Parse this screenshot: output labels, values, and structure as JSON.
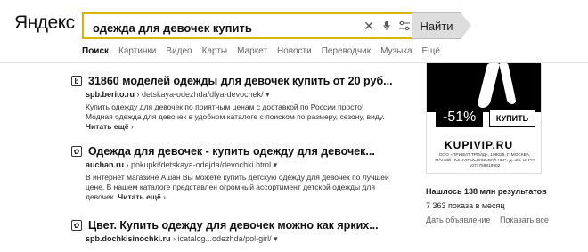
{
  "logo": {
    "text": "Яндекс"
  },
  "search": {
    "value": "одежда для девочек купить",
    "placeholder": "",
    "find_label": "Найти"
  },
  "tabs": [
    {
      "label": "Поиск"
    },
    {
      "label": "Картинки"
    },
    {
      "label": "Видео"
    },
    {
      "label": "Карты"
    },
    {
      "label": "Маркет"
    },
    {
      "label": "Новости"
    },
    {
      "label": "Переводчик"
    },
    {
      "label": "Музыка"
    },
    {
      "label": "Ещё"
    }
  ],
  "results": [
    {
      "title": "31860 моделей одежды для девочек купить от 20 руб...",
      "url_host": "spb.berito.ru",
      "url_path": "detskaya-odezhda/dlya-devochek/",
      "snippet_lines": [
        "Купить одежду для девочек по приятным ценам с доставкой по России просто!",
        "Модная одежда для девочек в удобном каталоге с поиском по размеру, сезону, виду."
      ],
      "more": "Читать ещё"
    },
    {
      "title": "Одежда для девочек - купить одежду для девочек...",
      "url_host": "auchan.ru",
      "url_path": "pokupki/detskaya-odejda/devochki.html",
      "snippet_lines": [
        "В интернет магазине Ашан Вы можете купить детскую одежду для девочек по лучшей",
        "цене. В нашем каталоге представлен огромный ассортимент детской одежды для",
        "девочек."
      ],
      "more": "Читать ещё"
    },
    {
      "title": "Цвет. Купить одежду для девочек можно как ярких...",
      "url_host": "spb.dochkisinochki.ru",
      "url_path": "icatalog...odezhda/pol-girl/",
      "snippet_lines": [],
      "more": ""
    }
  ],
  "ad": {
    "discount": "-51%",
    "buy": "КУПИТЬ",
    "brand": "KUPIVIP.RU",
    "fine": "ООО «ПРИВИТ ТРЕЙД», 109028, Г. МОСКВА, МАЛЫЙ ПОЛУЯРОСЛАВСКИЙ ПЕР., Д. 3/5, ОГРН 1077759818902"
  },
  "stats": {
    "found": "Нашлось 138 млн результатов",
    "per_month": "7 363 показа в месяц",
    "link1": "Дать объявление",
    "link2": "Показать все"
  }
}
